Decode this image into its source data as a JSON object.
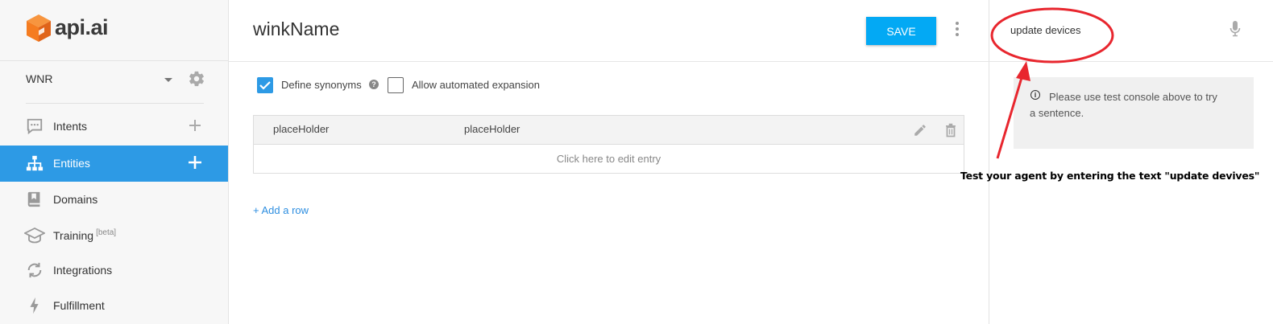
{
  "brand": {
    "logo_text": "api.ai",
    "accent": "#2d9ae5",
    "save_color": "#03a9f4",
    "logo_color": "#f57c20"
  },
  "sidebar": {
    "agent_name": "WNR",
    "items": [
      {
        "label": "Intents",
        "icon": "chat-icon",
        "has_add": true,
        "active": false
      },
      {
        "label": "Entities",
        "icon": "hierarchy-icon",
        "has_add": true,
        "active": true
      },
      {
        "label": "Domains",
        "icon": "book-icon",
        "has_add": false,
        "active": false
      },
      {
        "label": "Training",
        "badge": "[beta]",
        "icon": "graduation-cap-icon",
        "has_add": false,
        "active": false
      },
      {
        "label": "Integrations",
        "icon": "sync-icon",
        "has_add": false,
        "active": false
      },
      {
        "label": "Fulfillment",
        "icon": "bolt-icon",
        "has_add": false,
        "active": false
      }
    ]
  },
  "main": {
    "title": "winkName",
    "save_label": "SAVE",
    "define_synonyms_label": "Define synonyms",
    "define_synonyms_checked": true,
    "allow_expansion_label": "Allow automated expansion",
    "allow_expansion_checked": false,
    "entry": {
      "value": "placeHolder",
      "synonyms": "placeHolder"
    },
    "edit_entry_placeholder": "Click here to edit entry",
    "add_row_label": "+ Add a row"
  },
  "console": {
    "input_value": "update devices",
    "info_text": "Please use test console above to try a sentence."
  },
  "annotation": {
    "text": "Test your agent by entering the text \"update devives\"",
    "color": "#e8262e"
  }
}
